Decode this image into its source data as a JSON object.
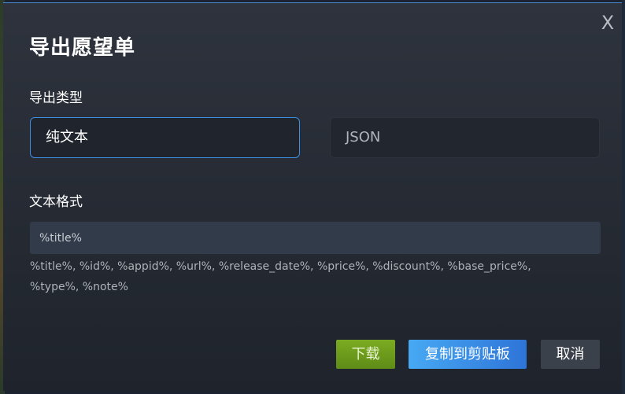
{
  "dialog": {
    "title": "导出愿望单",
    "close_label": "X"
  },
  "export_type": {
    "label": "导出类型",
    "options": [
      {
        "label": "纯文本",
        "selected": true
      },
      {
        "label": "JSON",
        "selected": false
      }
    ]
  },
  "text_format": {
    "label": "文本格式",
    "value": "%title%",
    "help": "%title%, %id%, %appid%, %url%, %release_date%, %price%, %discount%, %base_price%, %type%, %note%"
  },
  "buttons": {
    "download": "下载",
    "copy": "复制到剪贴板",
    "cancel": "取消"
  },
  "colors": {
    "accent_blue": "#3c8fe0",
    "download_green": "#6a9c1c",
    "copy_blue": "#3a8ee6"
  }
}
